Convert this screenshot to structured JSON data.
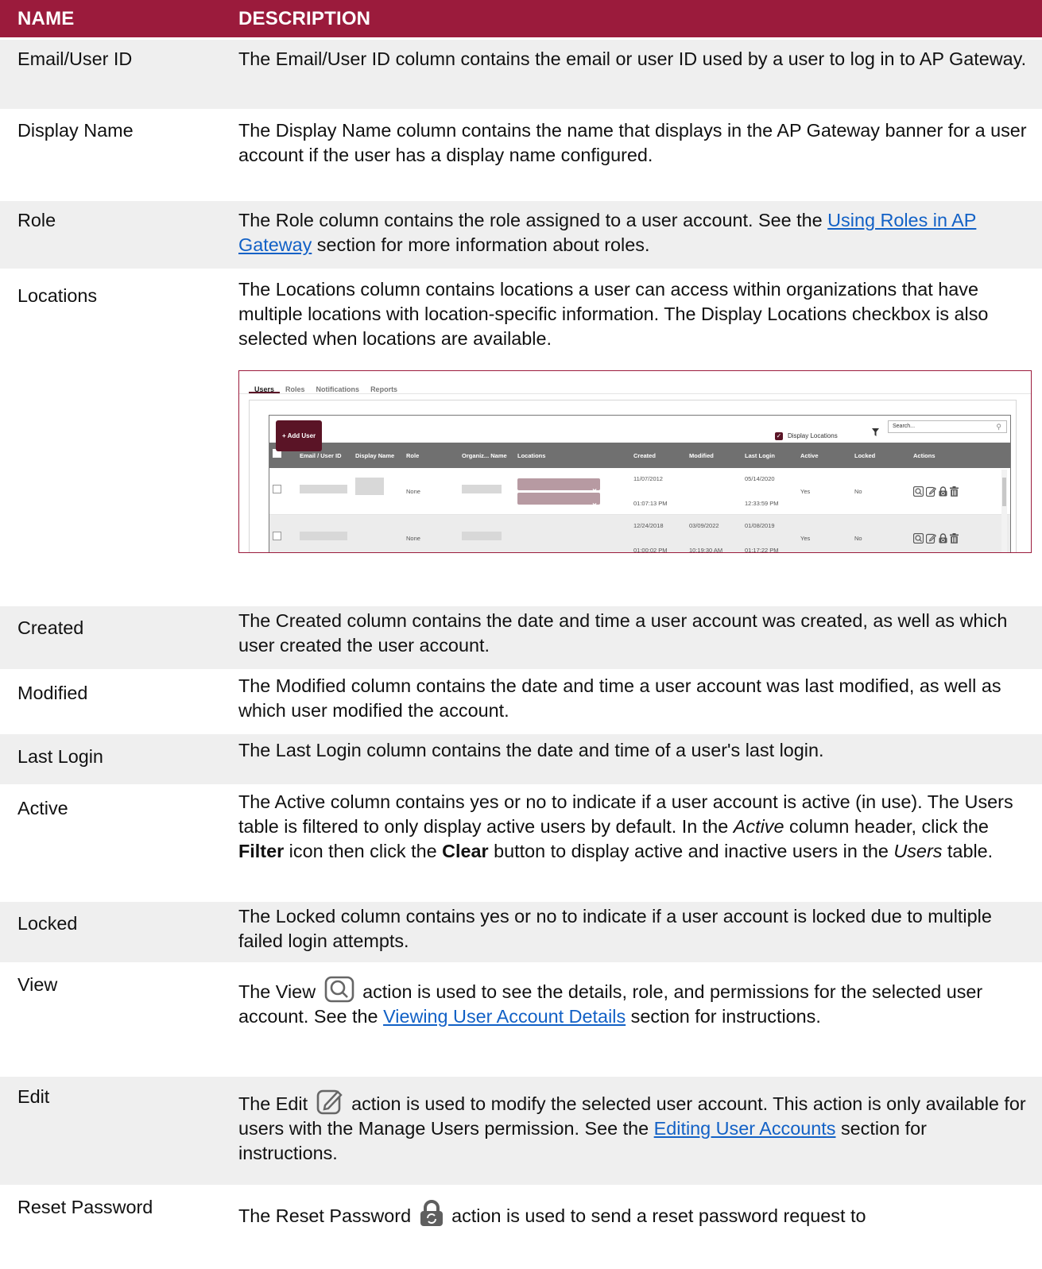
{
  "header": {
    "name": "NAME",
    "description": "DESCRIPTION"
  },
  "rows": {
    "email": {
      "name": "Email/User ID",
      "desc": "The Email/User ID column contains the email or user ID used by a user to log in to AP Gateway."
    },
    "display_name": {
      "name": "Display Name",
      "desc": "The Display Name column contains the name that displays in the AP Gateway banner for a user account if the user has a display name configured."
    },
    "role": {
      "name": "Role",
      "desc_before": "The Role column contains the role assigned to a user account. See the ",
      "link": "Using Roles in AP Gateway",
      "desc_after": " section for more information about roles."
    },
    "locations": {
      "name": "Locations",
      "desc": "The Locations column contains locations a user can access within organizations that have multiple locations with location-specific information. The Display Locations checkbox is also selected when locations are available."
    },
    "created": {
      "name": "Created",
      "desc": "The Created column contains the date and time a user account was created, as well as which user created the user account."
    },
    "modified": {
      "name": "Modified",
      "desc": "The Modified column contains the date and time a user account was last modified, as well as which user modified the account."
    },
    "last_login": {
      "name": "Last Login",
      "desc": "The Last Login column contains the date and time of a user's last login."
    },
    "active": {
      "name": "Active",
      "desc_1": "The Active column contains yes or no to indicate if a user account is active (in use). The Users table is filtered to only display active users by default. In the ",
      "em_1": "Active",
      "desc_2": " column header, click the ",
      "bold_1": "Filter",
      "desc_3": " icon then click the ",
      "bold_2": "Clear",
      "desc_4": " button to display active and inactive users in the ",
      "em_2": "Users",
      "desc_5": " table."
    },
    "locked": {
      "name": "Locked",
      "desc": "The Locked column contains yes or no to indicate if a user account is locked due to multiple failed login attempts."
    },
    "view": {
      "name": "View",
      "desc_before": "The View ",
      "desc_mid": " action is used to see the details, role, and permissions for the selected user account. See the ",
      "link": "Viewing User Account Details",
      "desc_after": " section for instructions."
    },
    "edit": {
      "name": "Edit",
      "desc_before": "The Edit ",
      "desc_mid": " action is used to modify the selected user account. This action is only available for users with the Manage Users permission. See the ",
      "link": "Editing User Accounts",
      "desc_after": " section for instructions."
    },
    "reset": {
      "name": "Reset Password",
      "desc_before": "The Reset Password ",
      "desc_after": " action is used to send a reset password request to"
    }
  },
  "screenshot": {
    "tabs": [
      "Users",
      "Roles",
      "Notifications",
      "Reports"
    ],
    "add_user": "+ Add User",
    "display_locations": "Display Locations",
    "search_placeholder": "Search...",
    "columns": {
      "email": "Email / User ID",
      "display": "Display Name",
      "role": "Role",
      "org": "Organiz... Name",
      "locations": "Locations",
      "created": "Created",
      "modified": "Modified",
      "last_login": "Last Login",
      "active": "Active",
      "locked": "Locked",
      "actions": "Actions"
    },
    "row1": {
      "role": "None",
      "created_date": "11/07/2012",
      "created_time": "01:07:13 PM",
      "login_date": "05/14/2020",
      "login_time": "12:33:59 PM",
      "active": "Yes",
      "locked": "No"
    },
    "row2": {
      "role": "None",
      "created_date": "12/24/2018",
      "created_time": "01:00:02 PM",
      "modified_date": "03/09/2022",
      "modified_time": "10:19:30 AM",
      "login_date": "01/08/2019",
      "login_time": "01:17:22 PM",
      "active": "Yes",
      "locked": "No"
    }
  },
  "colors": {
    "header_bg": "#9b1b3c",
    "row_gray": "#efefef",
    "link": "#1261c6",
    "brand_dark": "#5a1426"
  }
}
